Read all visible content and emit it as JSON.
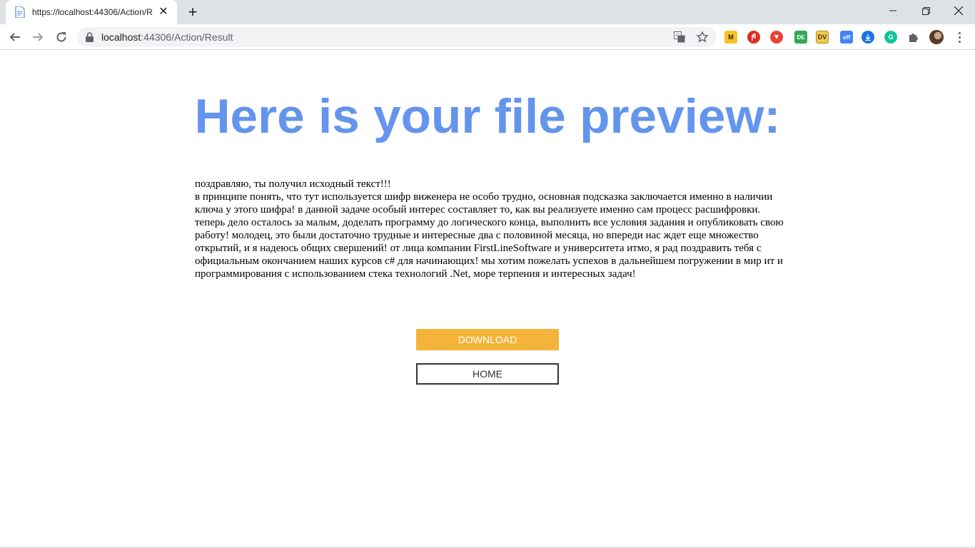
{
  "browser": {
    "tab_title": "https://localhost:44306/Action/R",
    "tab_close": "✕",
    "new_tab": "+",
    "url_host": "localhost",
    "url_rest": ":44306/Action/Result",
    "window_controls": [
      "minimize-icon",
      "restore-icon",
      "close-icon"
    ],
    "extensions": [
      {
        "name": "m-extension-icon",
        "text": "M",
        "color": "#f6c026"
      },
      {
        "name": "adblock-icon",
        "text": "",
        "color": "#d93025"
      },
      {
        "name": "red-extension-icon",
        "text": "",
        "color": "#ea4335"
      },
      {
        "name": "de-extension-icon",
        "text": "DE",
        "color": "#34a853"
      },
      {
        "name": "dv-extension-icon",
        "text": "DV",
        "color": "#f2c94c"
      },
      {
        "name": "off-extension-icon",
        "text": "off",
        "color": "#4285f4"
      },
      {
        "name": "download-extension-icon",
        "text": "",
        "color": "#1a73e8"
      },
      {
        "name": "grammarly-icon",
        "text": "",
        "color": "#15c39a"
      },
      {
        "name": "puzzle-icon",
        "text": "",
        "color": "#5f6368"
      }
    ]
  },
  "page": {
    "title": "Here is your file preview:",
    "preview_line1": "поздравляю, ты получил исходный текст!!!",
    "preview_body": "в принципе понять, что тут используется шифр виженера не особо трудно, основная подсказка заключается именно в наличии ключа у этого шифра! в данной задаче особый интерес составляет то, как вы реализуете именно сам процесс расшифровки. теперь дело осталось за малым, доделать программу до логического конца, выполнить все условия задания и опубликовать свою работу! молодец, это были достаточно трудные и интересные два с половиной месяца, но впереди нас ждет еще множество открытий, и я надеюсь общих свершений! от лица компании FirstLineSoftware и университета итмо, я рад поздравить тебя с официальным окончанием наших курсов c# для начинающих! мы хотим пожелать успехов в дальнейшем погружении в мир ит и программирования с использованием стека технологий .Net, море терпения и интересных задач!",
    "download_label": "Download",
    "home_label": "Home"
  },
  "colors": {
    "title": "#6495ed",
    "download_button": "#f4b43a",
    "home_border": "#333333"
  }
}
